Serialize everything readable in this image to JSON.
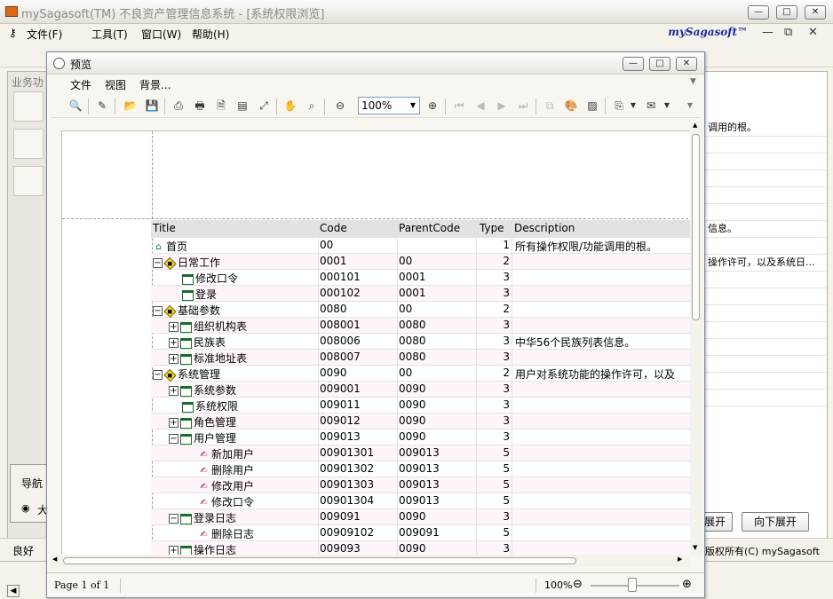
{
  "main_window": {
    "title": "mySagasoft(TM) 不良资产管理信息系统 - [系统权限浏览]",
    "menu": [
      "文件(F)",
      "工具(T)",
      "窗口(W)",
      "帮助(H)"
    ],
    "brand": "mySagasoft™",
    "left_panel_header": "业务功",
    "nav_label": "导航",
    "nav_radio_label": "大",
    "status_text": "良好",
    "copyright": "版权所有(C) mySagasoft",
    "buttons": {
      "expand_all": "展开",
      "expand_down": "向下展开"
    },
    "right_rows": [
      "调用的根。",
      "",
      "",
      "",
      "",
      "",
      "信息。",
      "",
      "操作许可，以及系统日...",
      "",
      "",
      "",
      "",
      "",
      "",
      "",
      ""
    ]
  },
  "preview": {
    "title": "预览",
    "menu": [
      "文件",
      "视图",
      "背景..."
    ],
    "zoom": "100%",
    "status_page": "Page 1 of 1",
    "status_zoom": "100%",
    "columns": [
      "Title",
      "Code",
      "ParentCode",
      "Type",
      "Description"
    ],
    "rows": [
      {
        "indent": 0,
        "expander": "",
        "icon": "home",
        "title": "首页",
        "code": "00",
        "parent": "",
        "type": "1",
        "desc": "所有操作权限/功能调用的根。"
      },
      {
        "indent": 0,
        "expander": "−",
        "icon": "folder",
        "title": "日常工作",
        "code": "0001",
        "parent": "00",
        "type": "2",
        "desc": ""
      },
      {
        "indent": 1,
        "expander": "",
        "icon": "page",
        "title": "修改口令",
        "code": "000101",
        "parent": "0001",
        "type": "3",
        "desc": ""
      },
      {
        "indent": 1,
        "expander": "",
        "icon": "page",
        "title": "登录",
        "code": "000102",
        "parent": "0001",
        "type": "3",
        "desc": ""
      },
      {
        "indent": 0,
        "expander": "−",
        "icon": "folder",
        "title": "基础参数",
        "code": "0080",
        "parent": "00",
        "type": "2",
        "desc": ""
      },
      {
        "indent": 1,
        "expander": "+",
        "icon": "page",
        "title": "组织机构表",
        "code": "008001",
        "parent": "0080",
        "type": "3",
        "desc": ""
      },
      {
        "indent": 1,
        "expander": "+",
        "icon": "page",
        "title": "民族表",
        "code": "008006",
        "parent": "0080",
        "type": "3",
        "desc": "中华56个民族列表信息。"
      },
      {
        "indent": 1,
        "expander": "+",
        "icon": "page",
        "title": "标准地址表",
        "code": "008007",
        "parent": "0080",
        "type": "3",
        "desc": ""
      },
      {
        "indent": 0,
        "expander": "−",
        "icon": "folder",
        "title": "系统管理",
        "code": "0090",
        "parent": "00",
        "type": "2",
        "desc": "用户对系统功能的操作许可，以及"
      },
      {
        "indent": 1,
        "expander": "+",
        "icon": "page",
        "title": "系统参数",
        "code": "009001",
        "parent": "0090",
        "type": "3",
        "desc": ""
      },
      {
        "indent": 1,
        "expander": "",
        "icon": "page",
        "title": "系统权限",
        "code": "009011",
        "parent": "0090",
        "type": "3",
        "desc": ""
      },
      {
        "indent": 1,
        "expander": "+",
        "icon": "page",
        "title": "角色管理",
        "code": "009012",
        "parent": "0090",
        "type": "3",
        "desc": ""
      },
      {
        "indent": 1,
        "expander": "−",
        "icon": "page",
        "title": "用户管理",
        "code": "009013",
        "parent": "0090",
        "type": "3",
        "desc": ""
      },
      {
        "indent": 2,
        "expander": "",
        "icon": "user",
        "title": "新加用户",
        "code": "00901301",
        "parent": "009013",
        "type": "5",
        "desc": ""
      },
      {
        "indent": 2,
        "expander": "",
        "icon": "user",
        "title": "删除用户",
        "code": "00901302",
        "parent": "009013",
        "type": "5",
        "desc": ""
      },
      {
        "indent": 2,
        "expander": "",
        "icon": "user",
        "title": "修改用户",
        "code": "00901303",
        "parent": "009013",
        "type": "5",
        "desc": ""
      },
      {
        "indent": 2,
        "expander": "",
        "icon": "user",
        "title": "修改口令",
        "code": "00901304",
        "parent": "009013",
        "type": "5",
        "desc": ""
      },
      {
        "indent": 1,
        "expander": "−",
        "icon": "page",
        "title": "登录日志",
        "code": "009091",
        "parent": "0090",
        "type": "3",
        "desc": ""
      },
      {
        "indent": 2,
        "expander": "",
        "icon": "user",
        "title": "删除日志",
        "code": "00909102",
        "parent": "009091",
        "type": "5",
        "desc": ""
      },
      {
        "indent": 1,
        "expander": "+",
        "icon": "page",
        "title": "操作日志",
        "code": "009093",
        "parent": "0090",
        "type": "3",
        "desc": ""
      }
    ]
  }
}
